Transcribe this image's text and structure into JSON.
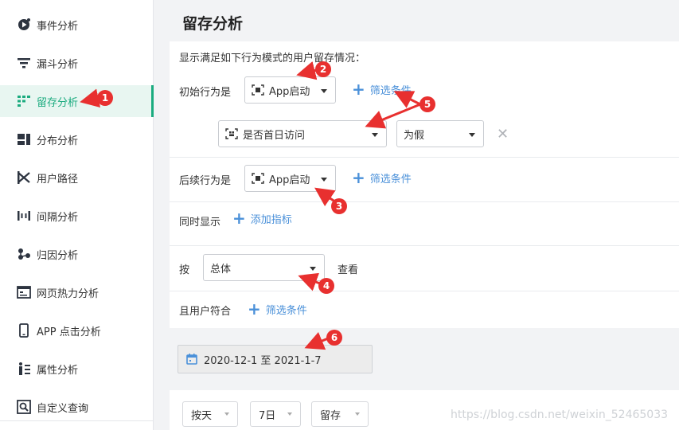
{
  "sidebar": {
    "items": [
      {
        "label": "事件分析",
        "icon": "event-analysis-icon"
      },
      {
        "label": "漏斗分析",
        "icon": "funnel-icon"
      },
      {
        "label": "留存分析",
        "icon": "retention-icon",
        "active": true
      },
      {
        "label": "分布分析",
        "icon": "distribution-icon"
      },
      {
        "label": "用户路径",
        "icon": "user-path-icon"
      },
      {
        "label": "间隔分析",
        "icon": "interval-icon"
      },
      {
        "label": "归因分析",
        "icon": "attribution-icon"
      },
      {
        "label": "网页热力分析",
        "icon": "heatmap-icon"
      },
      {
        "label": "APP 点击分析",
        "icon": "app-click-icon"
      },
      {
        "label": "属性分析",
        "icon": "attribute-icon"
      },
      {
        "label": "自定义查询",
        "icon": "custom-query-icon"
      }
    ],
    "active_color": "#1bab7f"
  },
  "page": {
    "title": "留存分析"
  },
  "form": {
    "intro": "显示满足如下行为模式的用户留存情况：",
    "initial_label": "初始行为是",
    "initial_event": "App启动",
    "filter_label": "筛选条件",
    "condition_property": "是否首日访问",
    "condition_value": "为假",
    "subsequent_label": "后续行为是",
    "subsequent_event": "App启动",
    "also_show_label": "同时显示",
    "add_metric_label": "添加指标",
    "by_label": "按",
    "group_by": "总体",
    "view_label": "查看",
    "user_match_label": "且用户符合",
    "user_filter_label": "筛选条件",
    "link_color": "#4a90d9"
  },
  "date_range": "2020-12-1 至 2021-1-7",
  "toolbar": {
    "granularity": "按天",
    "period": "7日",
    "metric": "留存"
  },
  "watermark": "https://blog.csdn.net/weixin_52465033",
  "annotations": [
    "1",
    "2",
    "3",
    "4",
    "5",
    "6"
  ],
  "annotation_color": "#e8302f"
}
